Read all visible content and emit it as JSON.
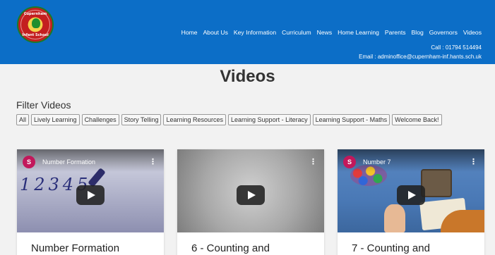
{
  "header": {
    "logo_text_top": "Cupernham",
    "logo_text_bottom": "Infant School",
    "nav": [
      "Home",
      "About Us",
      "Key Information",
      "Curriculum",
      "News",
      "Home Learning",
      "Parents",
      "Blog",
      "Governors",
      "Videos"
    ],
    "call": "Call : 01794 514494",
    "email": "Email : adminoffice@cupernham-inf.hants.sch.uk"
  },
  "page": {
    "title": "Videos",
    "filter_title": "Filter Videos",
    "filters": [
      "All",
      "Lively Learning",
      "Challenges",
      "Story Telling",
      "Learning Resources",
      "Learning Support - Literacy",
      "Learning Support - Maths",
      "Welcome Back!"
    ]
  },
  "cards": [
    {
      "channel_initial": "S",
      "video_title": "Number Formation",
      "card_title": "Number Formation",
      "thumb_text": "12345"
    },
    {
      "channel_initial": "",
      "video_title": "",
      "card_title": "6 - Counting and"
    },
    {
      "channel_initial": "S",
      "video_title": "Number 7",
      "card_title": "7 - Counting and"
    }
  ],
  "colors": {
    "header_bg": "#0c6ec7",
    "page_bg": "#f2f2f2",
    "avatar": "#c2185b"
  },
  "icons": {
    "menu": "vertical-dots-icon",
    "play": "youtube-play-icon"
  }
}
